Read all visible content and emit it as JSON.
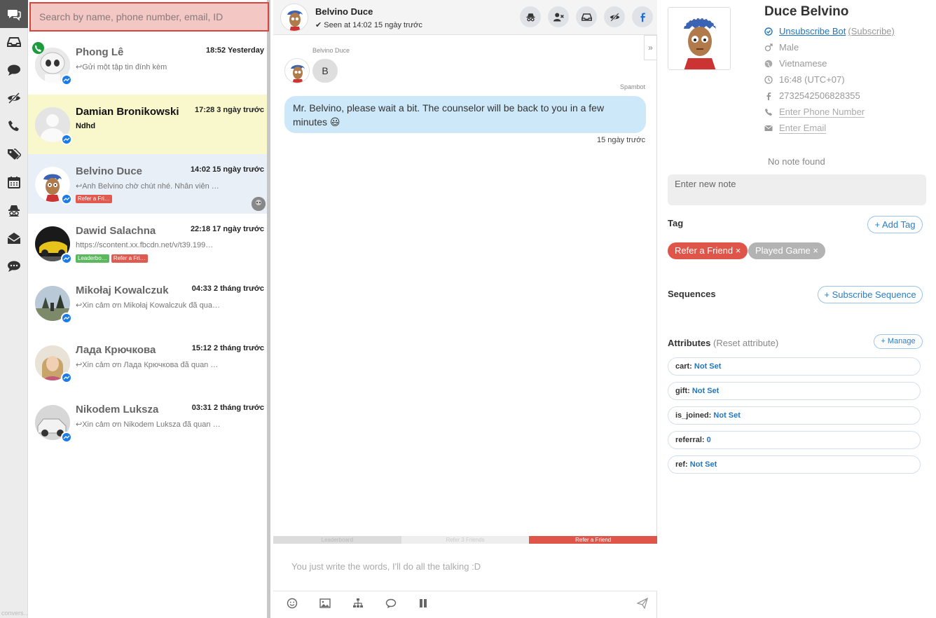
{
  "rail": {
    "items": [
      {
        "name": "conversations-icon",
        "active": true
      },
      {
        "name": "inbox-icon"
      },
      {
        "name": "chat-bubble-icon"
      },
      {
        "name": "eye-slash-icon"
      },
      {
        "name": "phone-icon"
      },
      {
        "name": "tags-icon"
      },
      {
        "name": "calendar-icon"
      },
      {
        "name": "spy-icon"
      },
      {
        "name": "envelope-open-icon"
      },
      {
        "name": "comment-dots-icon"
      }
    ],
    "footer": "convers..."
  },
  "search": {
    "placeholder": "Search by name, phone number, email, ID"
  },
  "conversations": [
    {
      "name": "Phong Lê",
      "time": "18:52 Yesterday",
      "preview": "Gửi một tập tin đính kèm",
      "has_phone": true,
      "tags": []
    },
    {
      "name": "Damian Bronikowski",
      "time": "17:28 3 ngày trước",
      "preview": "Ndhd",
      "unread": true,
      "tags": []
    },
    {
      "name": "Belvino Duce",
      "time": "14:02 15 ngày trước",
      "preview": "Anh Belvino chờ chút nhé. Nhân viên …",
      "selected": true,
      "tags": [
        {
          "label": "Refer a Fri…",
          "color": "#e05a4f"
        }
      ]
    },
    {
      "name": "Dawid Salachna",
      "time": "22:18 17 ngày trước",
      "preview": "https://scontent.xx.fbcdn.net/v/t39.199…",
      "tags": [
        {
          "label": "Leaderbo…",
          "color": "#5cb85c"
        },
        {
          "label": "Refer a Fri…",
          "color": "#e05a4f"
        }
      ]
    },
    {
      "name": "Mikołaj Kowalczuk",
      "time": "04:33 2 tháng trước",
      "preview": "Xin cảm ơn Mikołaj Kowalczuk đã qua…",
      "tags": []
    },
    {
      "name": "Лада Крючкова",
      "time": "15:12 2 tháng trước",
      "preview": "Xin cảm ơn Лада Крючкова đã quan …",
      "tags": []
    },
    {
      "name": "Nikodem Luksza",
      "time": "03:31 2 tháng trước",
      "preview": "Xin cảm ơn Nikodem Luksza đã quan …",
      "tags": []
    }
  ],
  "chat": {
    "header_name": "Belvino Duce",
    "seen": "Seen at 14:02 15 ngày trước",
    "header_buttons": [
      "spy-icon",
      "user-times-icon",
      "inbox-icon",
      "eye-slash-icon",
      "facebook-icon"
    ],
    "sender_label": "Belvino Duce",
    "incoming_text": "B",
    "bot_label": "Spambot",
    "outgoing_text": "Mr. Belvino, please wait a bit. The counselor will be back to you in a few minutes 😃",
    "message_time": "15 ngày trước",
    "quick_replies": [
      {
        "label": "Leaderboard",
        "color": "#dcdcdc",
        "text_color": "#bbbbbb"
      },
      {
        "label": "Refer 3 Friends",
        "color": "#eeeeee",
        "text_color": "#cccccc"
      },
      {
        "label": "Refer a Friend",
        "color": "#e0554a",
        "text_color": "#ffffff"
      }
    ],
    "composer_placeholder": "You just write the words, I'll do all the talking :D",
    "tools": [
      "smile-icon",
      "image-icon",
      "sitemap-icon",
      "comment-icon",
      "pause-icon",
      "send-icon"
    ]
  },
  "profile": {
    "name": "Duce Belvino",
    "unsubscribe": "Unsubscribe Bot",
    "subscribe": "(Subscribe)",
    "gender": "Male",
    "locale": "Vietnamese",
    "local_time": "16:48 (UTC+07)",
    "fb_id": "2732542506828355",
    "phone_placeholder": "Enter Phone Number",
    "email_placeholder": "Enter Email",
    "no_note": "No note found",
    "note_placeholder": "Enter new note",
    "tag_title": "Tag",
    "add_tag": "+ Add Tag",
    "tags": [
      {
        "label": "Refer a Friend ×",
        "color": "#e0554a"
      },
      {
        "label": "Played Game ×",
        "color": "#b3b3b3"
      }
    ],
    "sequences_title": "Sequences",
    "subscribe_sequence": "+ Subscribe Sequence",
    "attributes_title": "Attributes",
    "reset_attribute": "(Reset attribute)",
    "manage": "+ Manage",
    "attributes": [
      {
        "key": "cart:",
        "value": "Not Set"
      },
      {
        "key": "gift:",
        "value": "Not Set"
      },
      {
        "key": "is_joined:",
        "value": "Not Set"
      },
      {
        "key": "referral:",
        "value": "0"
      },
      {
        "key": "ref:",
        "value": "Not Set"
      }
    ]
  }
}
